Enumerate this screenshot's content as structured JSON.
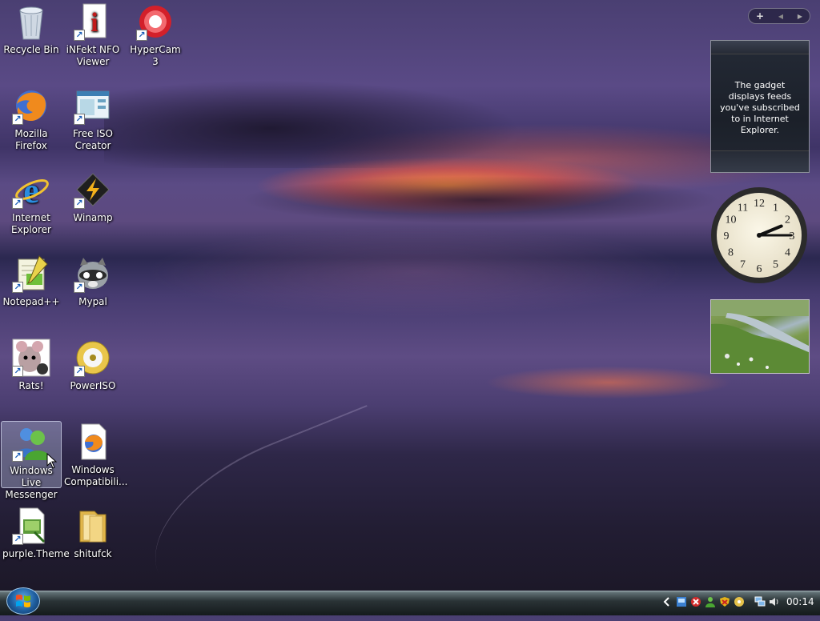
{
  "desktop": {
    "icons": [
      {
        "label": "Recycle Bin",
        "icon": "recycle-bin-icon"
      },
      {
        "label": "iNFekt NFO Viewer",
        "icon": "infekt-nfo-icon"
      },
      {
        "label": "HyperCam 3",
        "icon": "hypercam-icon"
      },
      {
        "label": "Mozilla Firefox",
        "icon": "firefox-icon"
      },
      {
        "label": "Free ISO Creator",
        "icon": "free-iso-creator-icon"
      },
      {
        "label": "Internet Explorer",
        "icon": "internet-explorer-icon"
      },
      {
        "label": "Winamp",
        "icon": "winamp-icon"
      },
      {
        "label": "Notepad++",
        "icon": "notepad-plus-plus-icon"
      },
      {
        "label": "Mypal",
        "icon": "mypal-icon"
      },
      {
        "label": "Rats!",
        "icon": "rats-icon"
      },
      {
        "label": "PowerISO",
        "icon": "poweriso-icon"
      },
      {
        "label": "Windows Live Messenger",
        "icon": "windows-live-messenger-icon"
      },
      {
        "label": "Windows Compatibili...",
        "icon": "windows-compatibility-icon"
      },
      {
        "label": "purple.Theme",
        "icon": "theme-file-icon"
      },
      {
        "label": "shitufck",
        "icon": "folder-icon"
      }
    ],
    "selected_icon": "Windows Live Messenger"
  },
  "sidebar": {
    "toolbar": {
      "add": "+",
      "prev": "◀",
      "next": "▶"
    },
    "feed_gadget": {
      "message": "The gadget displays feeds you've subscribed to in Internet Explorer."
    },
    "clock_gadget": {
      "numbers": [
        "12",
        "1",
        "2",
        "3",
        "4",
        "5",
        "6",
        "7",
        "8",
        "9",
        "10",
        "11"
      ],
      "hour": 2,
      "minute": 15
    },
    "slideshow_gadget": {
      "image": "stream-landscape"
    }
  },
  "taskbar": {
    "tray_icons": [
      "show-hidden-icons-chevron",
      "security-center-icon",
      "blocked-icon",
      "messenger-status-icon",
      "security-shield-icon",
      "media-icon",
      "network-icon",
      "volume-icon"
    ],
    "time": "00:14"
  }
}
